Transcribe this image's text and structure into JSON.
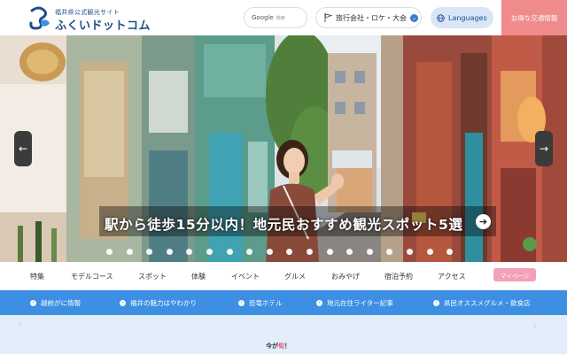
{
  "header": {
    "logo_subtitle": "福井県公式観光サイト",
    "logo_title": "ふくいドットコム",
    "search_brand": "Google",
    "search_placeholder": "検索",
    "travel_button": "旅行会社・ロケ・大会",
    "language_button": "Languages",
    "deal_button": "お得な交通情報"
  },
  "hero": {
    "caption": "駅から徒歩15分以内！地元民おすすめ観光スポット5選",
    "prev_icon": "arrow-left-icon",
    "next_icon": "arrow-right-icon",
    "slide_count": 18
  },
  "menu": {
    "items": [
      "特集",
      "モデルコース",
      "スポット",
      "体験",
      "イベント",
      "グルメ",
      "おみやげ",
      "宿泊予約",
      "アクセス"
    ],
    "mypage": "マイページ"
  },
  "links": [
    "越前がに情報",
    "福井の魅力はやわかり",
    "恐竜ホテル",
    "地元在住ライター記事",
    "県民オススメグルメ・飲食店"
  ],
  "section": {
    "label_prefix": "今が",
    "label_highlight": "旬",
    "label_suffix": "！"
  },
  "colors": {
    "brand": "#1f4e8a",
    "link_bar": "#3d8fe4",
    "deal": "#f08b8b",
    "mypage": "#f4a0b8"
  }
}
